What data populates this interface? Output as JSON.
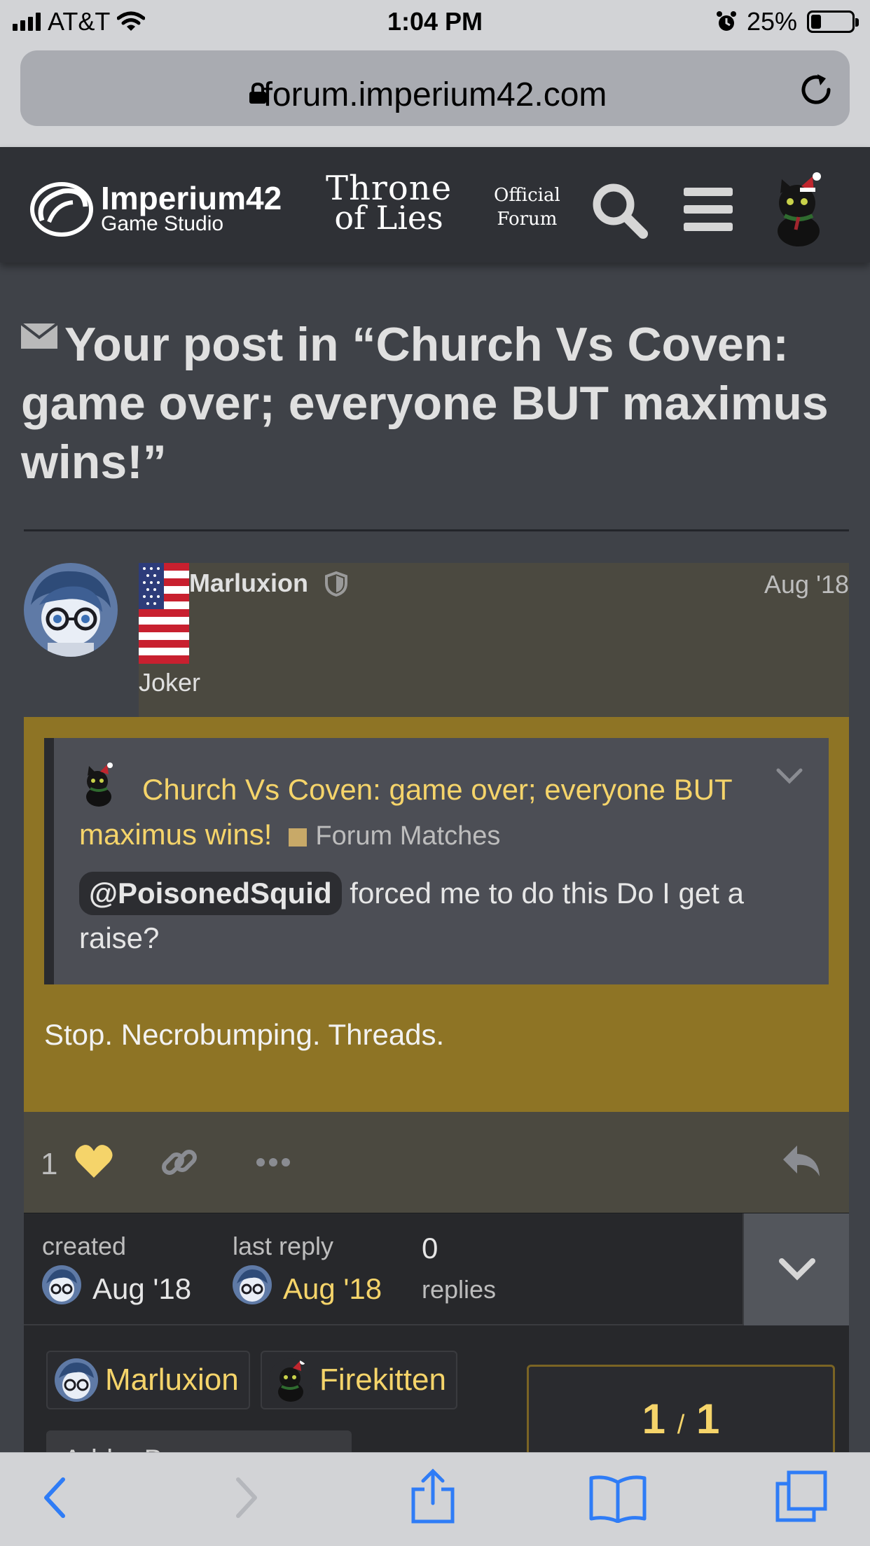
{
  "status_bar": {
    "carrier": "AT&T",
    "time": "1:04 PM",
    "battery_pct": 25,
    "battery_text": "25%"
  },
  "browser": {
    "url": "forum.imperium42.com"
  },
  "header": {
    "studio_name_line1": "Imperium42",
    "studio_name_line2": "Game Studio",
    "game_logo_line1": "Throne",
    "game_logo_line2": "of Lies",
    "official_line1": "Official",
    "official_line2": "Forum",
    "icons": [
      "search-icon",
      "hamburger-menu-icon",
      "user-avatar"
    ]
  },
  "topic": {
    "title": "Your post in “Church Vs Coven: game over; everyone BUT maximus wins!”"
  },
  "post": {
    "username": "Marluxion",
    "date": "Aug '18",
    "user_title": "Joker",
    "quote": {
      "title": "Church Vs Coven: game over; everyone BUT maximus wins!",
      "category": "Forum Matches",
      "mention": "@PoisonedSquid",
      "text": " forced me to do this Do I get a raise?"
    },
    "body": "Stop. Necrobumping. Threads.",
    "like_count": "1"
  },
  "topic_map": {
    "created_label": "created",
    "created_date": "Aug '18",
    "last_reply_label": "last reply",
    "last_reply_date": "Aug '18",
    "replies_count": "0",
    "replies_label": "replies",
    "participants": [
      "Marluxion",
      "Firekitten"
    ],
    "progress": {
      "current": "1",
      "total": "1",
      "sep": "/"
    },
    "partial_button": "Add a Bo"
  },
  "colors": {
    "page_bg": "#3f4248",
    "header_bg": "#2f3136",
    "highlight_post": "#8e7425",
    "link_yellow": "#f5d46a",
    "quote_bg": "#4c4e55"
  }
}
